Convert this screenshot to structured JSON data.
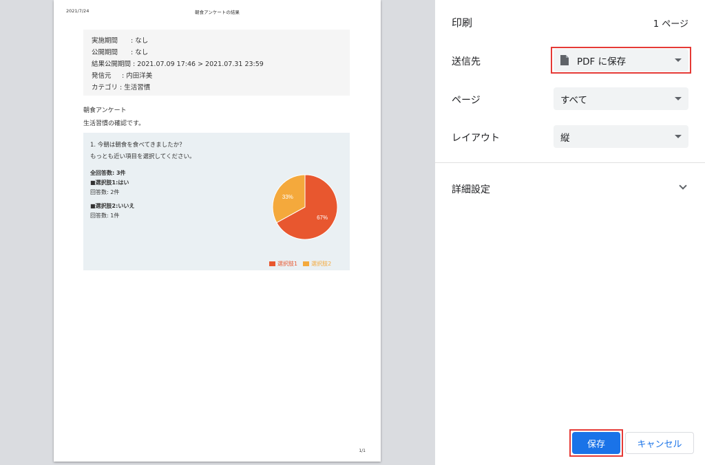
{
  "preview": {
    "date": "2021/7/24",
    "title": "朝食アンケートの結果",
    "page_num": "1/1",
    "meta": [
      {
        "key": "実施期間　　",
        "val": ": なし"
      },
      {
        "key": "公開期間　　",
        "val": ": なし"
      },
      {
        "key": "結果公開期間",
        "val": " : 2021.07.09 17:46 > 2021.07.31 23:59"
      },
      {
        "key": "発信元　",
        "val": "  : 内田洋美"
      },
      {
        "key": "カテゴリ",
        "val": " : 生活習慣"
      }
    ],
    "survey_title": "朝食アンケート",
    "survey_desc": "生活習慣の確認です。",
    "question": {
      "title": "1. 今朝は朝食を食べてきましたか？",
      "instruction": "もっとも近い項目を選択してください。",
      "total": "全回答数: 3件",
      "option1_label": "■選択肢1:はい",
      "option1_count": "回答数: 2件",
      "option2_label": "■選択肢2:いいえ",
      "option2_count": "回答数: 1件"
    },
    "chart_data": {
      "type": "pie",
      "categories": [
        "選択肢1",
        "選択肢2"
      ],
      "values": [
        67,
        33
      ],
      "labels": [
        "67%",
        "33%"
      ],
      "colors": [
        "#e8572f",
        "#f4a93c"
      ],
      "legend": "bottom-right"
    }
  },
  "panel": {
    "title": "印刷",
    "page_count": "1 ページ",
    "destination_label": "送信先",
    "destination_value": "PDF に保存",
    "destination_icon": "document-icon",
    "pages_label": "ページ",
    "pages_value": "すべて",
    "layout_label": "レイアウト",
    "layout_value": "縦",
    "more_settings": "詳細設定",
    "save": "保存",
    "cancel": "キャンセル"
  },
  "colors": {
    "accent": "#1a73e8",
    "highlight": "#e53935"
  }
}
